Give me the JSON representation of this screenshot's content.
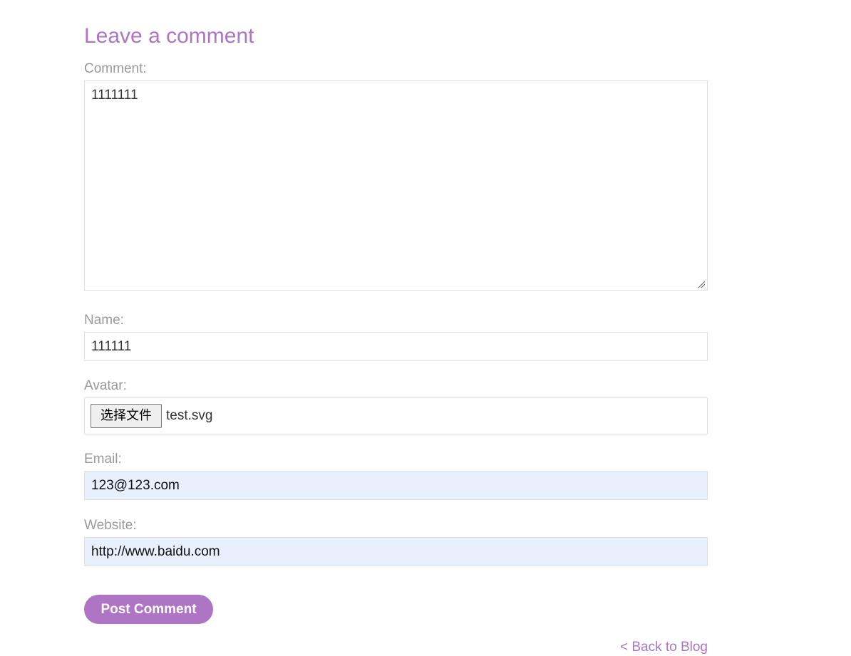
{
  "form": {
    "heading": "Leave a comment",
    "comment": {
      "label": "Comment:",
      "value": "1111111"
    },
    "name": {
      "label": "Name:",
      "value": "111111"
    },
    "avatar": {
      "label": "Avatar:",
      "button_label": "选择文件",
      "file_name": "test.svg"
    },
    "email": {
      "label": "Email:",
      "value": "123@123.com"
    },
    "website": {
      "label": "Website:",
      "value": "http://www.baidu.com"
    },
    "submit_label": "Post Comment"
  },
  "footer": {
    "back_link": "< Back to Blog"
  },
  "colors": {
    "accent": "#ad75c4",
    "label": "#999999",
    "autofill_bg": "#e8f0fe",
    "border": "#e0e0e0"
  }
}
